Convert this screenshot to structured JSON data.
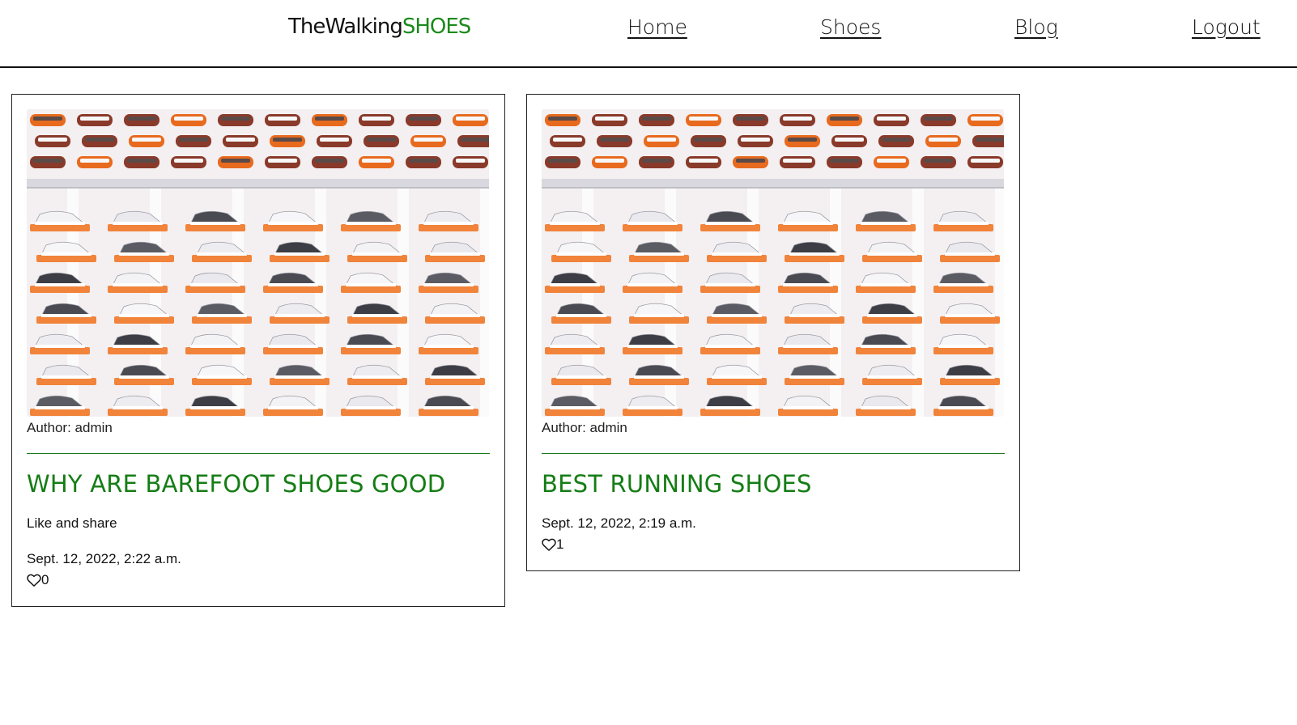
{
  "brand": {
    "name_prefix": "TheWalking",
    "name_accent": "SHOES",
    "accent_color": "#1b8a1b"
  },
  "nav": {
    "items": [
      {
        "label": "Home"
      },
      {
        "label": "Shoes"
      },
      {
        "label": "Blog"
      },
      {
        "label": "Logout"
      }
    ]
  },
  "posts": [
    {
      "image_alt": "Wall display of sneakers on orange shelves",
      "author": "Author: admin",
      "title": "WHY ARE BAREFOOT SHOES GOOD",
      "excerpt": "Like and share",
      "date": "Sept. 12, 2022, 2:22 a.m.",
      "likes": "0",
      "like_icon": "heart-outline-icon"
    },
    {
      "image_alt": "Wall display of sneakers on orange shelves",
      "author": "Author: admin",
      "title": "BEST RUNNING SHOES",
      "excerpt": "",
      "date": "Sept. 12, 2022, 2:19 a.m.",
      "likes": "1",
      "like_icon": "heart-outline-icon"
    }
  ]
}
